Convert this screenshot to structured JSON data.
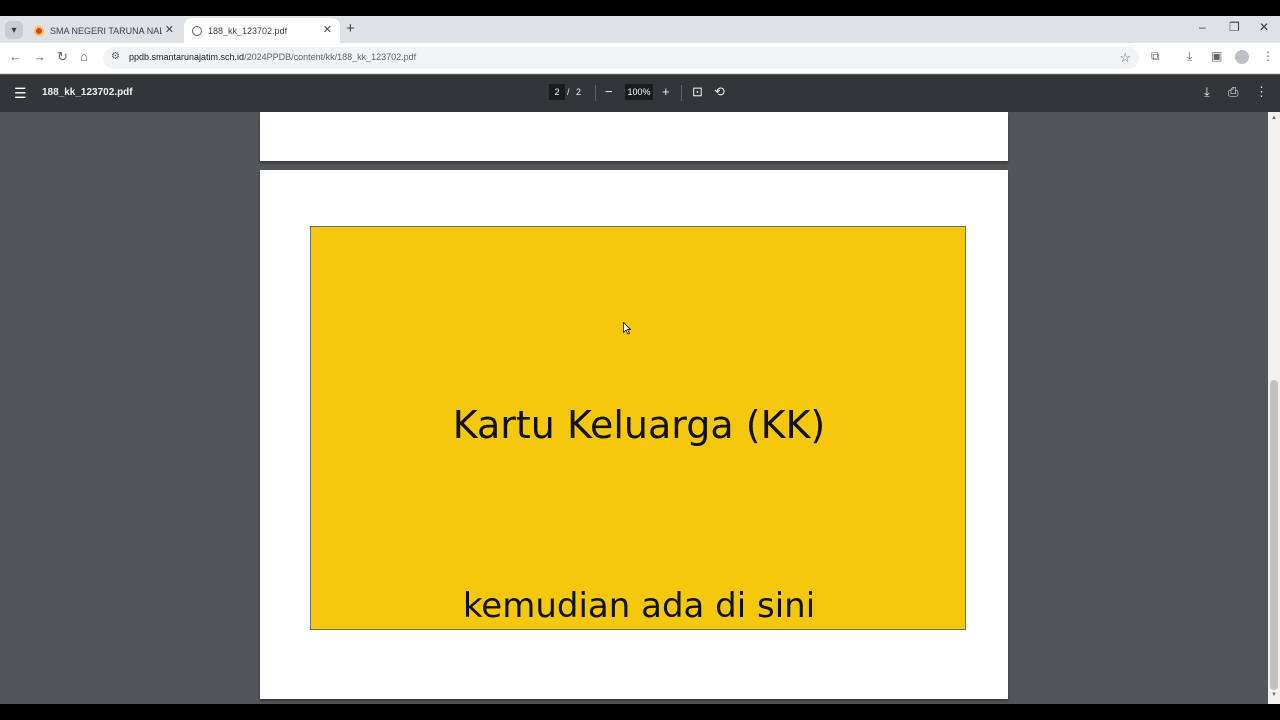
{
  "tabs": [
    {
      "title": "SMA NEGERI TARUNA NALA JA",
      "active": false
    },
    {
      "title": "188_kk_123702.pdf",
      "active": true
    }
  ],
  "toolbar": {
    "url_host": "ppdb.smantarunajatim.sch.id",
    "url_path": "/2024PPDB/content/kk/188_kk_123702.pdf"
  },
  "pdf": {
    "filename": "188_kk_123702.pdf",
    "current_page": "2",
    "separator": "/",
    "total_pages": "2",
    "zoom": "100%"
  },
  "document": {
    "title": "Kartu Keluarga (KK)",
    "subtitle": "kemudian ada di sini",
    "box_color": "#f6c80d"
  },
  "icons": {
    "tab_search": "chevron-down-icon",
    "back": "arrow-left-icon",
    "forward": "arrow-right-icon",
    "reload": "reload-icon",
    "home": "home-icon"
  }
}
